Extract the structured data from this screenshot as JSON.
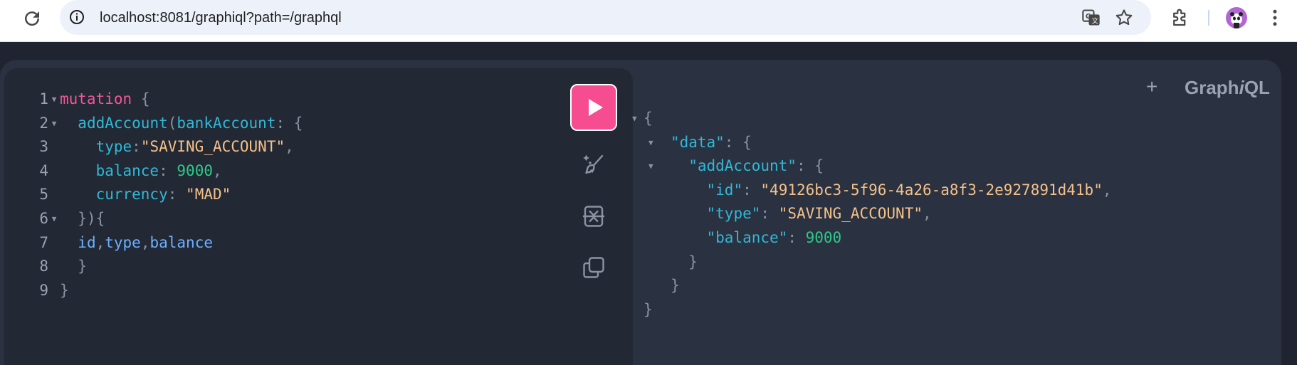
{
  "browser": {
    "url": "localhost:8081/graphiql?path=/graphql",
    "icons": [
      "reload-icon",
      "site-info-icon",
      "translate-icon",
      "bookmark-star-icon",
      "extensions-icon",
      "profile-avatar",
      "more-menu-icon"
    ]
  },
  "graphiql": {
    "logo_prefix": "Graph",
    "logo_italic": "i",
    "logo_suffix": "QL",
    "add_tab_label": "+",
    "accent_color": "#f54d8f"
  },
  "editor": {
    "line_numbers": [
      "1",
      "2",
      "3",
      "4",
      "5",
      "6",
      "7",
      "8",
      "9"
    ],
    "line1": {
      "kw": "mutation",
      "brace": "{"
    },
    "line2": {
      "field": "addAccount",
      "paren": "(",
      "arg": "bankAccount",
      "colon": ":",
      "brace": "{"
    },
    "line3": {
      "key": "type",
      "colon": ":",
      "value": "\"SAVING_ACCOUNT\"",
      "comma": ","
    },
    "line4": {
      "key": "balance",
      "colon": ":",
      "value": "9000",
      "comma": ","
    },
    "line5": {
      "key": "currency",
      "colon": ":",
      "value": "\"MAD\""
    },
    "line6": {
      "text": "}){"
    },
    "line7": {
      "f1": "id",
      "c1": ",",
      "f2": "type",
      "c2": ",",
      "f3": "balance"
    },
    "line8": {
      "text": "}"
    },
    "line9": {
      "text": "}"
    }
  },
  "result": {
    "open": "{",
    "data_key": "\"data\"",
    "colon": ":",
    "brace": "{",
    "add_key": "\"addAccount\"",
    "id_key": "\"id\"",
    "id_value": "\"49126bc3-5f96-4a26-a8f3-2e927891d41b\"",
    "type_key": "\"type\"",
    "type_value": "\"SAVING_ACCOUNT\"",
    "balance_key": "\"balance\"",
    "balance_value": "9000",
    "comma": ",",
    "close": "}"
  }
}
